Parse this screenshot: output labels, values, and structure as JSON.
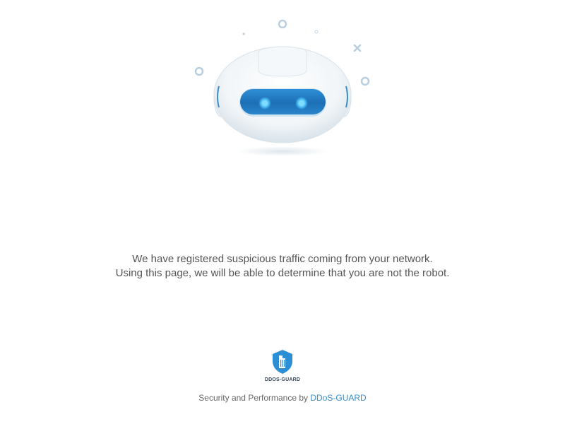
{
  "illustration": {
    "name": "robot-icon",
    "accent_color": "#1e72b8",
    "eye_color": "#4fc3f7"
  },
  "message": {
    "line1": "We have registered suspicious traffic coming from your network.",
    "line2": "Using this page, we will be able to determine that you are not the robot."
  },
  "logo": {
    "icon": "shield-icon",
    "text": "DDOS-GUARD",
    "color": "#2c8fd6"
  },
  "footer": {
    "prefix": "Security and Performance by",
    "link_text": "DDoS-GUARD",
    "link_color": "#3a8ec8"
  }
}
